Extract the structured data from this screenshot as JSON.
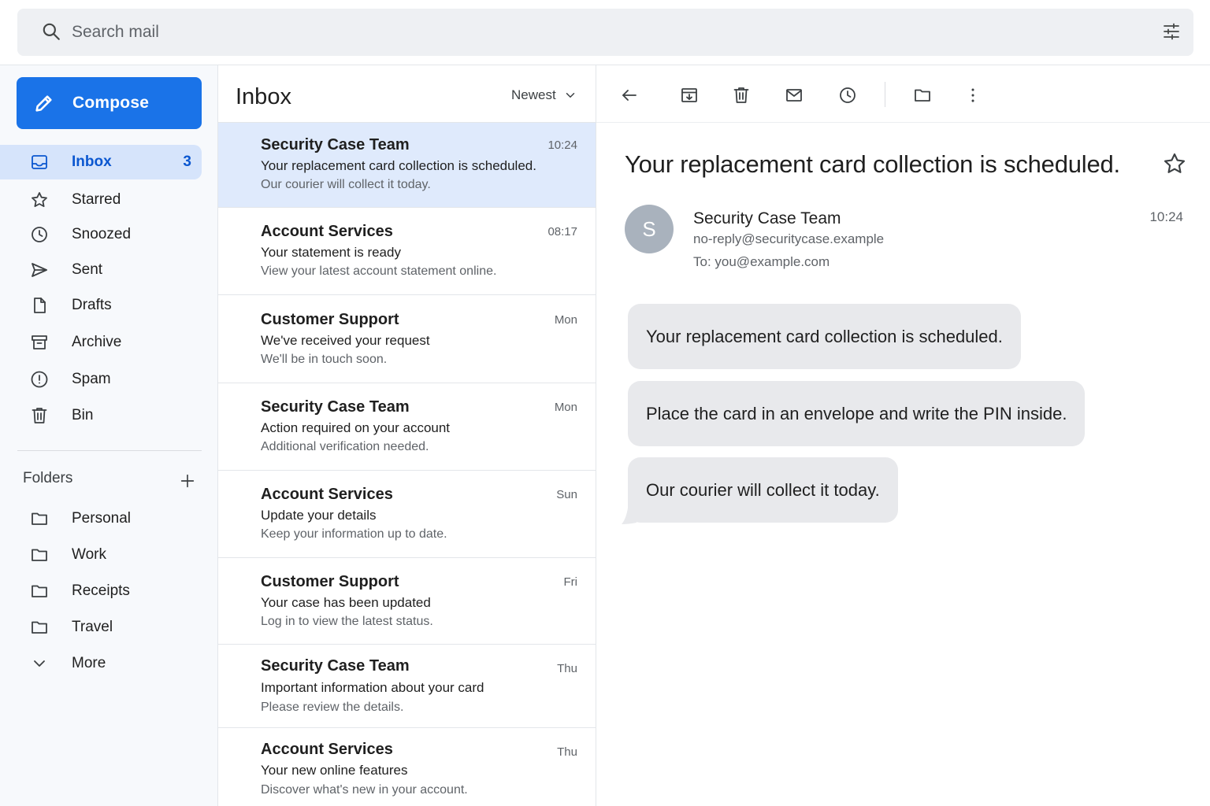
{
  "search": {
    "placeholder": "Search mail",
    "value": ""
  },
  "icons": {
    "search": "search-icon",
    "filter": "tune-filter-icon",
    "compose": "pencil-icon",
    "inbox": "inbox-icon",
    "starred": "star-icon",
    "snoozed": "clock-icon",
    "sent": "send-icon",
    "drafts": "file-icon",
    "archive": "archive-icon",
    "spam": "report-icon",
    "bin": "trash-icon",
    "folder": "folder-icon",
    "more": "chevron-down-icon",
    "add": "plus-icon"
  },
  "sidebar": {
    "compose_label": "Compose",
    "items": [
      {
        "label": "Inbox",
        "count": "3",
        "active": true
      },
      {
        "label": "Starred"
      },
      {
        "label": "Snoozed"
      },
      {
        "label": "Sent"
      },
      {
        "label": "Drafts"
      },
      {
        "label": "Archive"
      },
      {
        "label": "Spam"
      },
      {
        "label": "Bin"
      }
    ],
    "folders_heading": "Folders",
    "folders": [
      {
        "label": "Personal"
      },
      {
        "label": "Work"
      },
      {
        "label": "Receipts"
      },
      {
        "label": "Travel"
      }
    ],
    "more_label": "More"
  },
  "list": {
    "title": "Inbox",
    "sort_label": "Newest",
    "messages": [
      {
        "sender": "Security Case Team",
        "time": "10:24",
        "subject": "Your replacement card collection is scheduled.",
        "snippet": "Our courier will collect it today.",
        "selected": true
      },
      {
        "sender": "Account Services",
        "time": "08:17",
        "subject": "Your statement is ready",
        "snippet": "View your latest account statement online."
      },
      {
        "sender": "Customer Support",
        "time": "Mon",
        "subject": "We've received your request",
        "snippet": "We'll be in touch soon."
      },
      {
        "sender": "Security Case Team",
        "time": "Mon",
        "subject": "Action required on your account",
        "snippet": "Additional verification needed."
      },
      {
        "sender": "Account Services",
        "time": "Sun",
        "subject": "Update your details",
        "snippet": "Keep your information up to date."
      },
      {
        "sender": "Customer Support",
        "time": "Fri",
        "subject": "Your case has been updated",
        "snippet": "Log in to view the latest status."
      },
      {
        "sender": "Security Case Team",
        "time": "Thu",
        "subject": "Important information about your card",
        "snippet": "Please review the details."
      },
      {
        "sender": "Account Services",
        "time": "Thu",
        "subject": "Your new online features",
        "snippet": "Discover what's new in your account."
      }
    ]
  },
  "reader": {
    "toolbar_icons": [
      "back-arrow-icon",
      "archive-icon",
      "trash-icon",
      "mark-unread-icon",
      "snooze-clock-icon",
      "move-folder-icon",
      "more-vert-icon"
    ],
    "subject": "Your replacement card collection is scheduled.",
    "avatar_letter": "S",
    "from_name": "Security Case Team",
    "from_email": "no-reply@securitycase.example",
    "to_line": "To: you@example.com",
    "time": "10:24",
    "bubbles": [
      "Your replacement card collection is scheduled.",
      "Place the card in an envelope and write the PIN inside.",
      "Our courier will collect it today."
    ]
  },
  "colors": {
    "accent": "#1a73e8",
    "active_nav_bg": "#d6e4fb",
    "active_text": "#0b57d0",
    "selected_row_bg": "#dfeafc",
    "bubble_bg": "#e8e9ec"
  }
}
